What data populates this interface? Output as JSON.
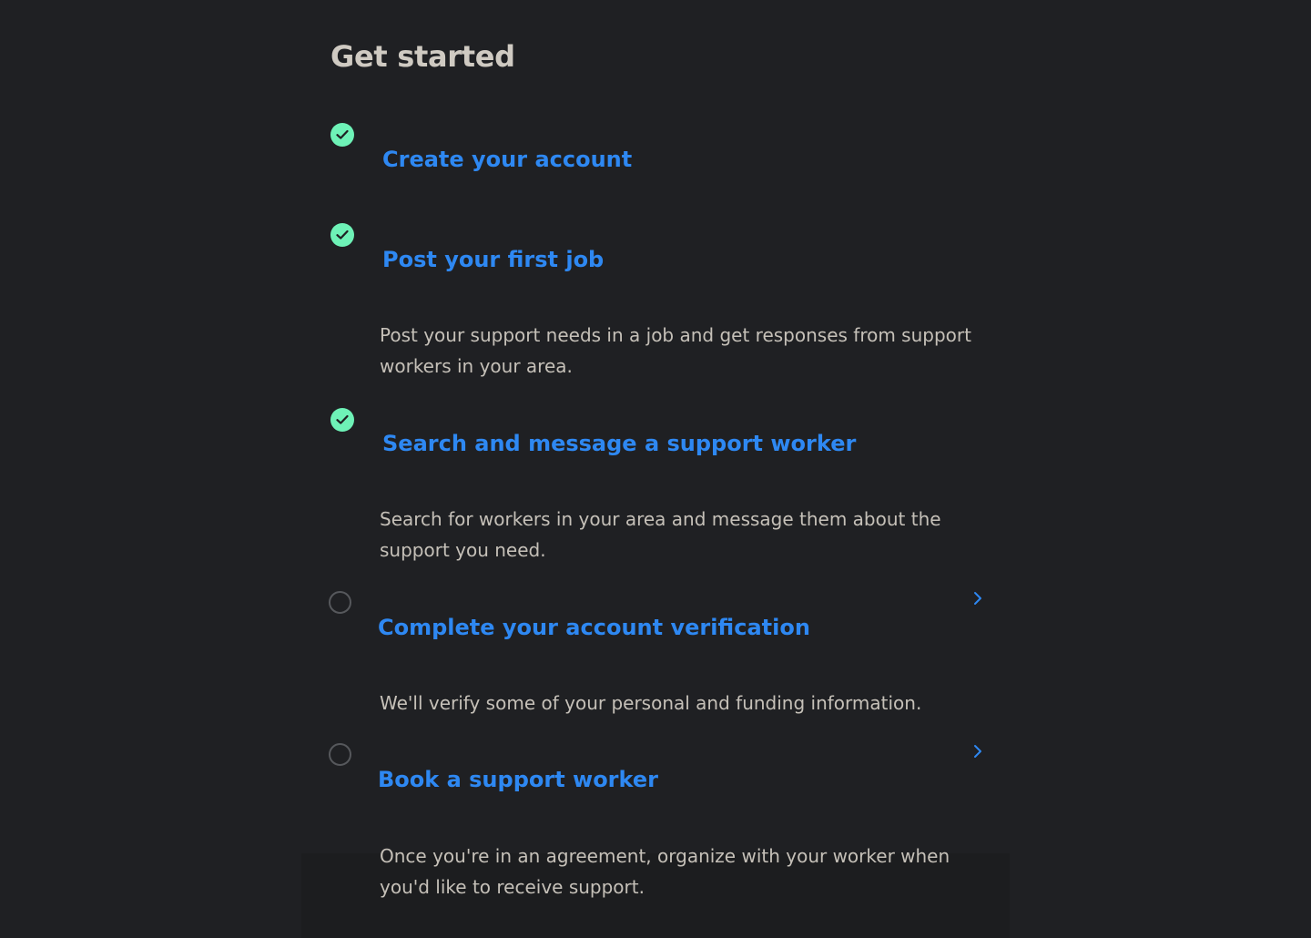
{
  "header": {
    "title": "Get started"
  },
  "colors": {
    "background": "#1f2023",
    "accent": "#2e88f2",
    "complete": "#6ef2b7",
    "text": "#c5c0b8",
    "title": "#cfcac2"
  },
  "steps": [
    {
      "title": "Create your account",
      "description": "",
      "completed": true,
      "status_icon": "check-circle-icon"
    },
    {
      "title": "Post your first job",
      "description": "Post your support needs in a job and get responses from support workers in your area.",
      "completed": true,
      "status_icon": "check-circle-icon"
    },
    {
      "title": "Search and message a support worker",
      "description": "Search for workers in your area and message them about the support you need.",
      "completed": true,
      "status_icon": "check-circle-icon"
    },
    {
      "title": "Complete your account verification",
      "description": "We'll verify some of your personal and funding information.",
      "completed": false,
      "status_icon": "empty-circle-icon",
      "action_icon": "chevron-right-icon"
    },
    {
      "title": "Book a support worker",
      "description": "Once you're in an agreement, organize with your worker when you'd like to receive support.",
      "completed": false,
      "status_icon": "empty-circle-icon",
      "action_icon": "chevron-right-icon"
    }
  ]
}
